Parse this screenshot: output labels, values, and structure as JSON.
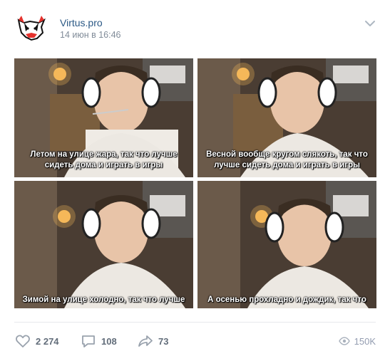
{
  "post": {
    "author": "Virtus.pro",
    "date": "14 июн в 16:46"
  },
  "images": [
    {
      "caption": "Летом на улице жара, так что лучше сидеть дома и играть в игры"
    },
    {
      "caption": "Весной вообще кругом слякоть, так что лучше сидеть дома и играть в игры"
    },
    {
      "caption": "Зимой на улице холодно, так что лучше"
    },
    {
      "caption": "А осенью прохладно и дождик, так что"
    }
  ],
  "footer": {
    "likes": "2 274",
    "comments": "108",
    "shares": "73",
    "views": "150K"
  },
  "icons": {
    "avatar": "virtus-pro-bear-logo",
    "menu": "chevron-down-icon",
    "like": "heart-icon",
    "comment": "comment-icon",
    "share": "share-icon",
    "views": "eye-icon"
  },
  "colors": {
    "author_link": "#2a5885",
    "meta": "#818c99",
    "action": "#626d7a"
  }
}
